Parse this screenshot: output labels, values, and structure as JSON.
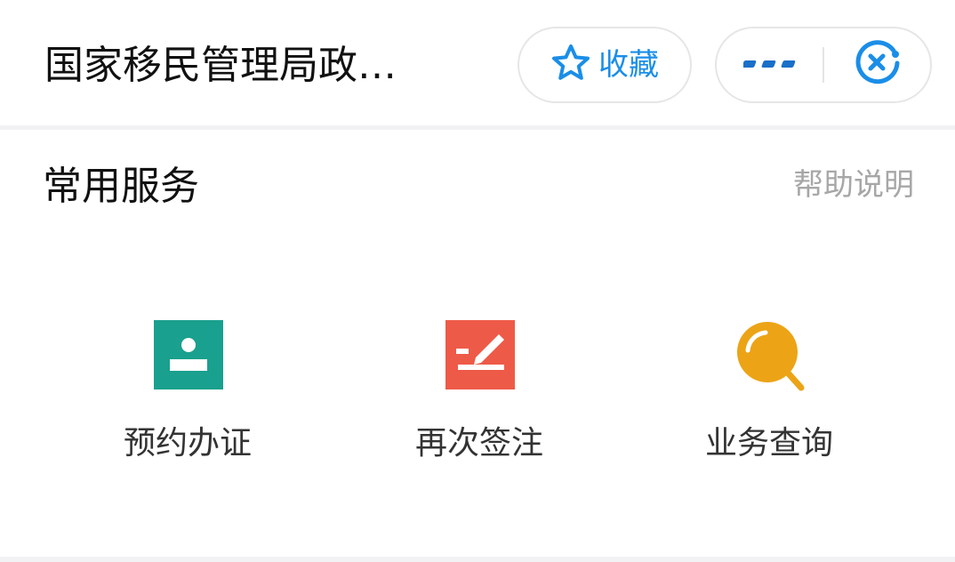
{
  "header": {
    "title": "国家移民管理局政…",
    "favorite_label": "收藏",
    "favorite_icon": "star-outline-icon",
    "more_icon": "more-dots-icon",
    "close_icon": "close-circle-icon",
    "accent_color": "#1a8ee8"
  },
  "section": {
    "title": "常用服务",
    "help_label": "帮助说明"
  },
  "services": [
    {
      "label": "预约办证",
      "icon": "id-card-icon",
      "color": "#1aa08e"
    },
    {
      "label": "再次签注",
      "icon": "sign-pen-icon",
      "color": "#ee5a48"
    },
    {
      "label": "业务查询",
      "icon": "magnifier-icon",
      "color": "#eca416"
    }
  ]
}
